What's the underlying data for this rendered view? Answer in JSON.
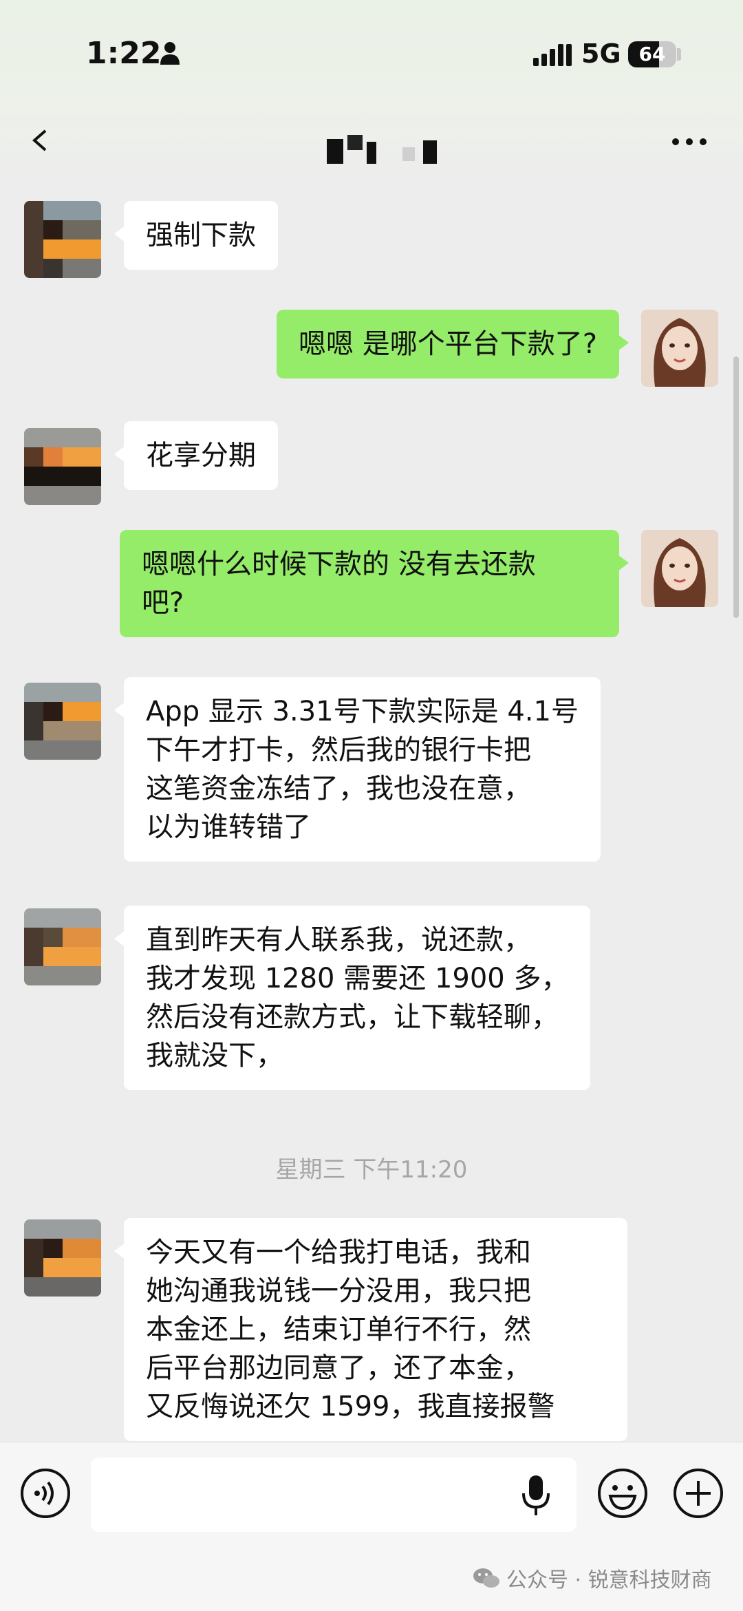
{
  "status_bar": {
    "time": "1:22",
    "network": "5G",
    "battery": "64",
    "battery_level": 0.64
  },
  "header": {
    "back_icon": "back-arrow-icon",
    "title_obscured": true,
    "more_icon": "more-dots-icon"
  },
  "messages": [
    {
      "side": "in",
      "text": "强制下款"
    },
    {
      "side": "out",
      "text": "嗯嗯 是哪个平台下款了?"
    },
    {
      "side": "in",
      "text": "花享分期"
    },
    {
      "side": "out",
      "lines": [
        "嗯嗯什么时候下款的 没有去还款",
        "吧?"
      ]
    },
    {
      "side": "in",
      "lines": [
        "App 显示 3.31号下款实际是 4.1号",
        "下午才打卡，然后我的银行卡把",
        "这笔资金冻结了，我也没在意，",
        "以为谁转错了"
      ]
    },
    {
      "side": "in",
      "lines": [
        "直到昨天有人联系我，说还款，",
        "我才发现 1280 需要还 1900 多，",
        "然后没有还款方式，让下载轻聊，",
        "我就没下，"
      ]
    },
    {
      "side": "in",
      "lines": [
        "今天又有一个给我打电话，我和",
        "她沟通我说钱一分没用，我只把",
        "本金还上，结束订单行不行，然",
        "后平台那边同意了，还了本金，",
        "又反悔说还欠 1599，我直接报警"
      ]
    }
  ],
  "timestamp": "星期三 下午11:20",
  "input_bar": {
    "voice_icon": "voice-icon",
    "input_value": "",
    "mic_icon": "microphone-icon",
    "emoji_icon": "emoji-icon",
    "plus_icon": "plus-icon"
  },
  "watermark": {
    "text": "公众号 · 锐意科技财商",
    "icon": "wechat-icon"
  },
  "colors": {
    "chat_background": "#ededed",
    "outgoing_bubble": "#95ec69",
    "incoming_bubble": "#ffffff"
  }
}
